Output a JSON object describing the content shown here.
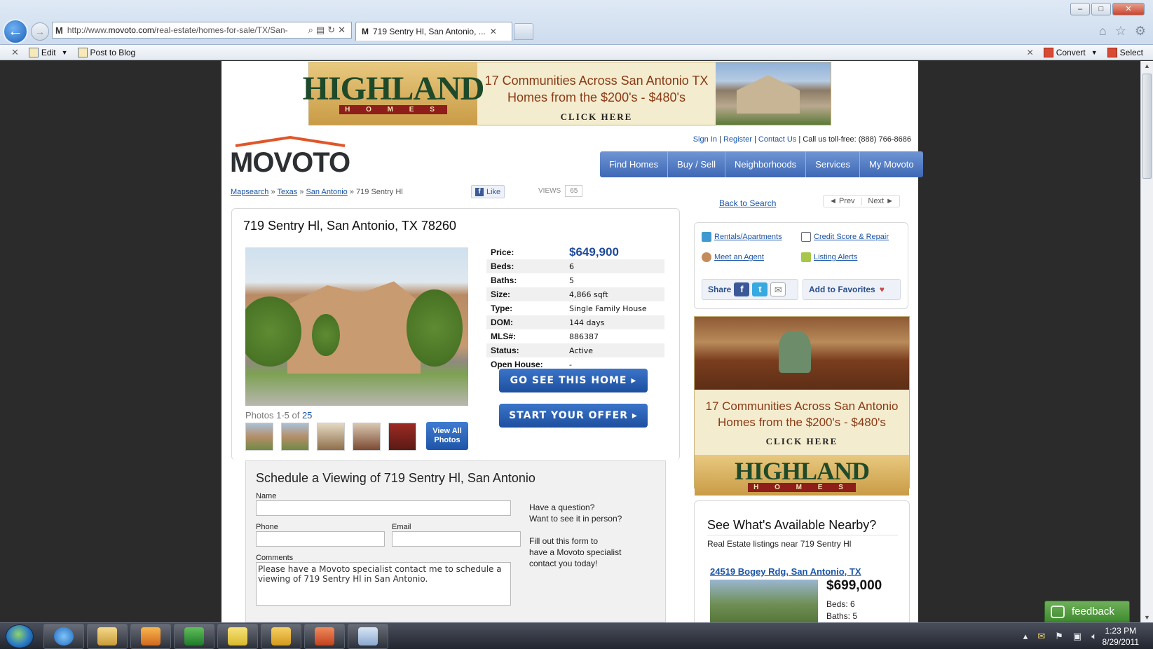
{
  "browser": {
    "url_prefix": "http://www.",
    "url_domain": "movoto.com",
    "url_path": "/real-estate/homes-for-sale/TX/San-",
    "tab_title": "719 Sentry Hl, San Antonio, ...",
    "tab_favicon": "M",
    "commands": {
      "edit": "Edit",
      "post_to_blog": "Post to Blog",
      "convert": "Convert",
      "select": "Select"
    }
  },
  "banner_ad": {
    "brand": "HIGHLAND",
    "sub": "H O M E S",
    "line1": "17 Communities Across San Antonio TX",
    "line2": "Homes from the $200's - $480's",
    "cta": "CLICK HERE"
  },
  "header": {
    "logo": "MOVOTO",
    "util": {
      "sign_in": "Sign In",
      "register": "Register",
      "contact": "Contact Us",
      "toll_free": "Call us toll-free: (888) 766-8686",
      "sep": "|"
    },
    "nav": [
      "Find Homes",
      "Buy / Sell",
      "Neighborhoods",
      "Services",
      "My Movoto"
    ]
  },
  "breadcrumb": {
    "mapsearch": "Mapsearch",
    "state": "Texas",
    "city": "San Antonio",
    "current": "719 Sentry Hl",
    "sep": "»"
  },
  "social": {
    "like": "Like",
    "views_label": "VIEWS",
    "views_count": "65"
  },
  "listing": {
    "title": "719 Sentry Hl, San Antonio, TX 78260",
    "photos_caption": "Photos 1-5 of",
    "photos_total": "25",
    "view_all": "View All Photos",
    "facts": [
      {
        "label": "Price:",
        "value": "$649,900"
      },
      {
        "label": "Beds:",
        "value": "6"
      },
      {
        "label": "Baths:",
        "value": "5"
      },
      {
        "label": "Size:",
        "value": "4,866 sqft"
      },
      {
        "label": "Type:",
        "value": "Single Family House"
      },
      {
        "label": "DOM:",
        "value": "144 days"
      },
      {
        "label": "MLS#:",
        "value": "886387"
      },
      {
        "label": "Status:",
        "value": "Active"
      },
      {
        "label": "Open House:",
        "value": "-"
      }
    ],
    "cta_see": "GO SEE THIS HOME",
    "cta_offer": "START YOUR OFFER"
  },
  "schedule": {
    "title": "Schedule a Viewing of 719 Sentry Hl, San Antonio",
    "name_label": "Name",
    "phone_label": "Phone",
    "email_label": "Email",
    "comments_label": "Comments",
    "comments_value": "Please have a Movoto specialist contact me to schedule a viewing of 719 Sentry Hl in San Antonio.",
    "side_q1": "Have a question?",
    "side_q2": "Want to see it in person?",
    "side_p1": "Fill out this form to",
    "side_p2": "have a Movoto specialist",
    "side_p3": "contact you today!"
  },
  "sidebar": {
    "back_to_search": "Back to Search",
    "prev": "◄ Prev",
    "next": "Next ►",
    "tools": {
      "rentals": "Rentals/Apartments",
      "credit": "Credit Score & Repair",
      "agent": "Meet an Agent",
      "alerts": "Listing Alerts"
    },
    "share": "Share",
    "add_fav": "Add to Favorites"
  },
  "side_ad": {
    "line1": "17 Communities Across San Antonio",
    "line2": "Homes from the $200's - $480's",
    "cta": "CLICK HERE",
    "brand": "HIGHLAND",
    "sub": "H O M E S"
  },
  "nearby": {
    "title": "See What's Available Nearby?",
    "subtitle": "Real Estate listings near 719 Sentry Hl",
    "item_address": "24519 Bogey Rdg, San Antonio, TX",
    "item_price": "$699,000",
    "item_beds": "Beds: 6",
    "item_baths": "Baths: 5"
  },
  "feedback": "feedback",
  "taskbar": {
    "time": "1:23 PM",
    "date": "8/29/2011"
  },
  "colors": {
    "nav_blue": "#4a74c0",
    "price_blue": "#1f4a9a",
    "link_blue": "#1b55a6",
    "logo_orange": "#e0562a",
    "feedback_green": "#4f9a3c"
  }
}
